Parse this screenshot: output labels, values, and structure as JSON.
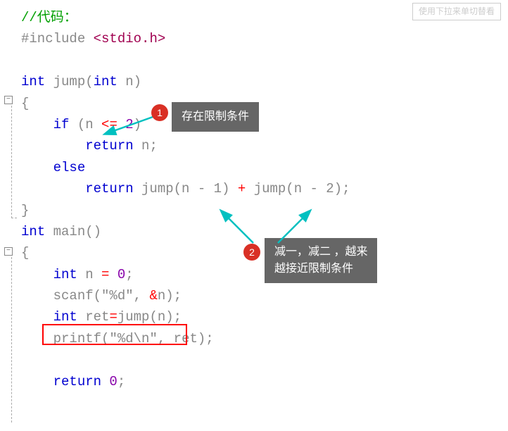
{
  "comment": "//代码：",
  "include_directive": "#include ",
  "include_path": "<stdio.h>",
  "func1_sig_type": "int ",
  "func1_sig_name": "jump",
  "func1_sig_paren_open": "(",
  "func1_param_type": "int ",
  "func1_param_name": "n",
  "func1_sig_paren_close": ")",
  "brace_open": "{",
  "brace_close": "}",
  "if_kw": "    if ",
  "if_cond_open": "(",
  "if_cond_var": "n ",
  "if_cond_op": "<= ",
  "if_cond_val": "2",
  "if_cond_close": ")",
  "return_kw": "        return ",
  "return_n": "n",
  "semi": ";",
  "else_kw": "    else",
  "return_kw2": "        return ",
  "jump_call1": "jump",
  "jump_arg1_open": "(",
  "jump_arg1_expr": "n - 1",
  "jump_arg1_close": ") ",
  "plus": "+ ",
  "jump_call2": "jump",
  "jump_arg2_open": "(",
  "jump_arg2_expr": "n - 2",
  "jump_arg2_close": ")",
  "func2_sig_type": "int ",
  "func2_sig_name": "main",
  "func2_parens": "()",
  "decl_int": "    int ",
  "decl_n": "n ",
  "decl_eq": "= ",
  "decl_zero": "0",
  "scanf_name": "    scanf",
  "scanf_open": "(",
  "scanf_fmt": "\"%d\"",
  "scanf_comma": ", ",
  "scanf_amp": "&",
  "scanf_var": "n",
  "scanf_close": ")",
  "ret_decl_int": "    int ",
  "ret_decl_name": "ret",
  "ret_decl_eq": "=",
  "ret_decl_call": "jump",
  "ret_decl_open": "(",
  "ret_decl_arg": "n",
  "ret_decl_close": ")",
  "printf_name": "    printf",
  "printf_open": "(",
  "printf_fmt": "\"%d\\n\"",
  "printf_comma": ", ",
  "printf_arg": "ret",
  "printf_close": ")",
  "return0_kw": "    return ",
  "return0_val": "0",
  "annotation1": "存在限制条件",
  "annotation2_line1": "减一，减二 ，越来",
  "annotation2_line2": "越接近限制条件",
  "badge1": "1",
  "badge2": "2",
  "ghost_btn": "使用下拉来单切替看",
  "fold_minus": "−"
}
